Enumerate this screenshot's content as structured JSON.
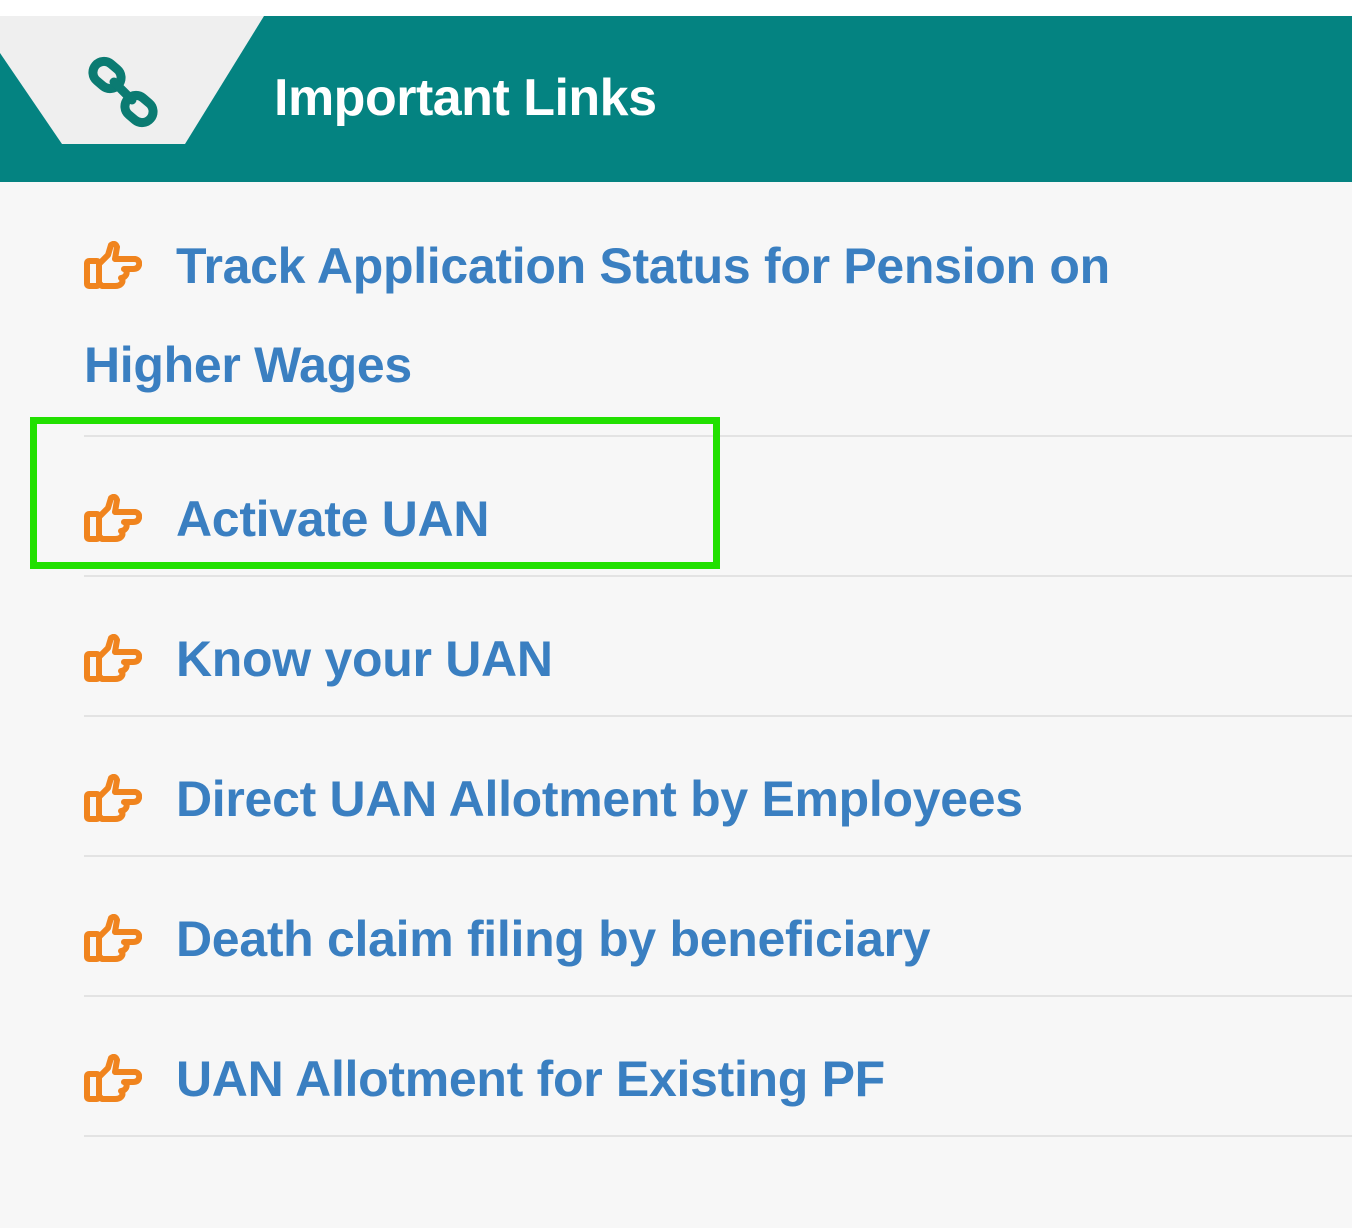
{
  "header": {
    "title": "Important Links",
    "icon": "link-icon"
  },
  "links": [
    {
      "line1": "Track Application Status for Pension on",
      "line2": "Higher Wages",
      "icon": "pointing-hand-icon"
    },
    {
      "label": "Activate UAN",
      "icon": "pointing-hand-icon",
      "highlighted": true
    },
    {
      "label": "Know your UAN",
      "icon": "pointing-hand-icon"
    },
    {
      "label": "Direct UAN Allotment by Employees",
      "icon": "pointing-hand-icon"
    },
    {
      "label": "Death claim filing by beneficiary",
      "icon": "pointing-hand-icon"
    },
    {
      "label": "UAN Allotment for Existing PF",
      "icon": "pointing-hand-icon"
    }
  ],
  "colors": {
    "header_bg": "#048381",
    "link_text": "#3a7fc1",
    "icon": "#f0841e",
    "highlight": "#22e000"
  }
}
